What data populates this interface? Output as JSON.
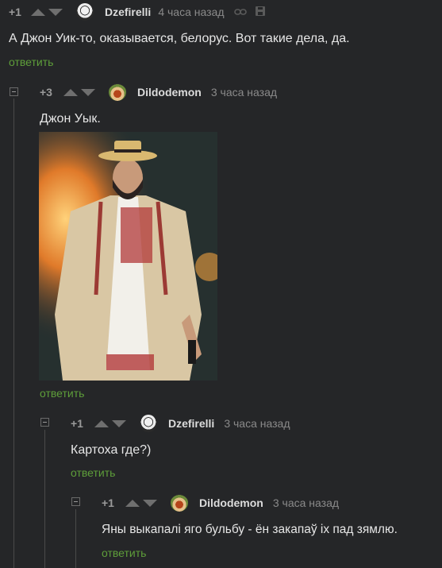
{
  "comments": [
    {
      "rating": "+1",
      "author": "Dzefirelli",
      "time": "4 часа назад",
      "text": "А Джон Уик-то, оказывается, белорус. Вот такие дела, да.",
      "reply_label": "ответить"
    },
    {
      "rating": "+3",
      "author": "Dildodemon",
      "time": "3 часа назад",
      "text": "Джон Уык.",
      "reply_label": "ответить"
    },
    {
      "rating": "+1",
      "author": "Dzefirelli",
      "time": "3 часа назад",
      "text": "Картоха где?)",
      "reply_label": "ответить"
    },
    {
      "rating": "+1",
      "author": "Dildodemon",
      "time": "3 часа назад",
      "text": "Яны выкапалі яго бульбу - ён закапаў іх пад зямлю.",
      "reply_label": "ответить"
    }
  ],
  "colors": {
    "background": "#252628",
    "reply_link": "#5e9e3a",
    "meta_text": "#8a8a8a"
  }
}
